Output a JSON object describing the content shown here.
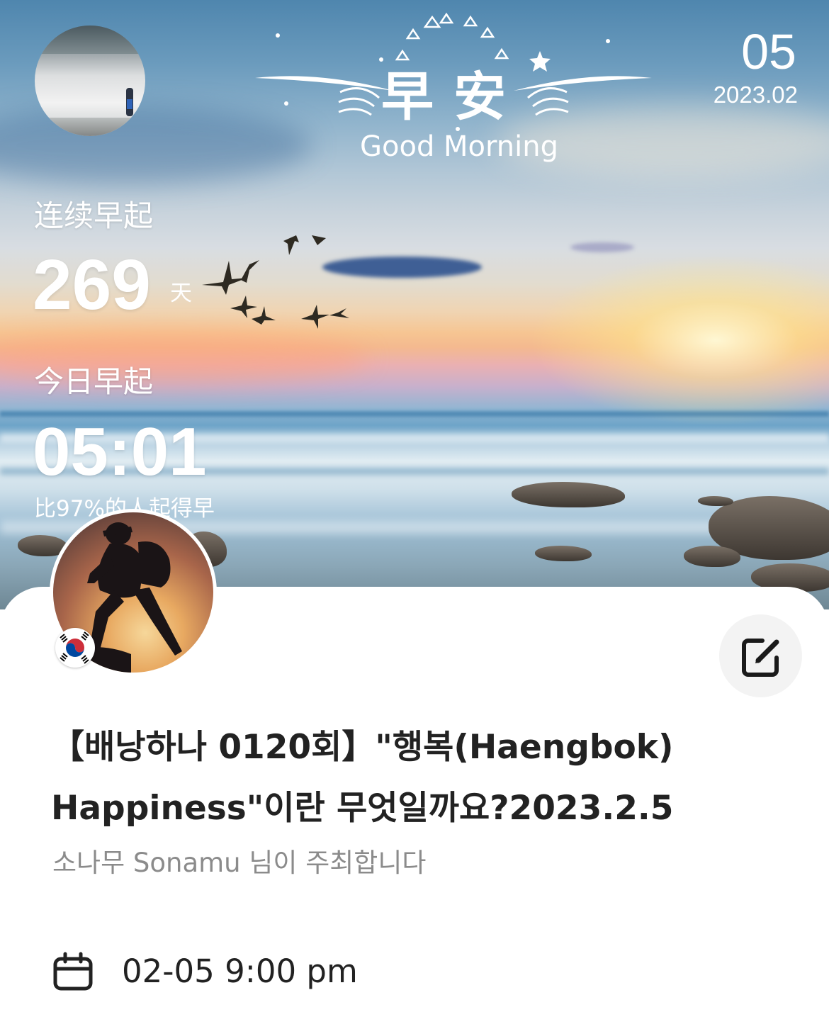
{
  "header": {
    "greeting_cn": "早安",
    "greeting_en": "Good Morning",
    "day": "05",
    "year_month": "2023.02"
  },
  "stats": {
    "streak_label": "连续早起",
    "streak_value": "269",
    "streak_unit": "天",
    "today_label": "今日早起",
    "today_time": "05:01",
    "rank_text": "比97%的人起得早"
  },
  "event": {
    "title": "【배낭하나 0120회】\"행복(Haengbok) Happiness\"이란 무엇일까요?2023.2.5",
    "host_line": "소나무 Sonamu 님이 주최합니다",
    "datetime": "02-05 9:00 pm"
  },
  "icons": {
    "edit": "edit-icon",
    "calendar": "calendar-icon",
    "flag": "south-korea-flag-icon"
  },
  "colors": {
    "title_text": "#222222",
    "host_text": "#8b8b8b",
    "edit_button_bg": "#f3f3f3"
  }
}
